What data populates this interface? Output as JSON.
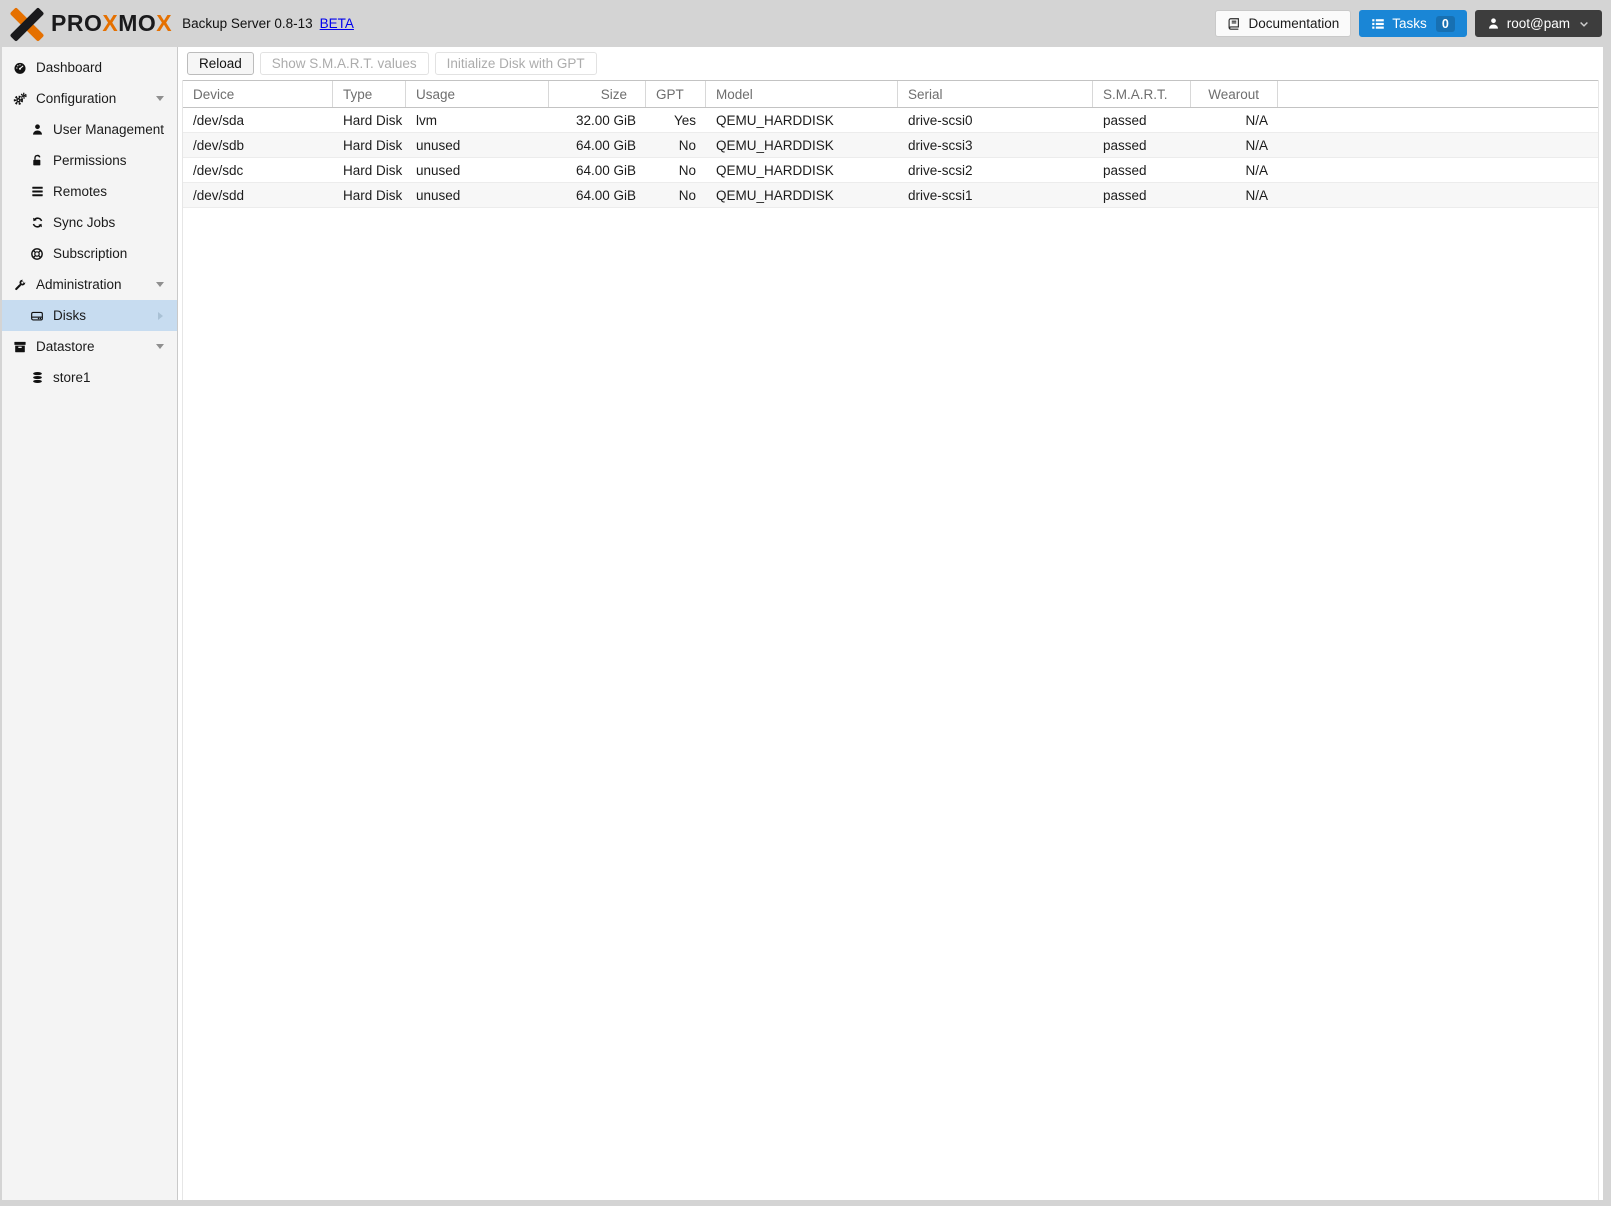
{
  "header": {
    "logo": {
      "part1": "PRO",
      "part2": "X",
      "part3": "MO",
      "part4": "X"
    },
    "product": "Backup Server 0.8-13",
    "beta": "BETA",
    "documentation_label": "Documentation",
    "tasks_label": "Tasks",
    "tasks_count": "0",
    "user": "root@pam"
  },
  "sidebar": {
    "items": [
      {
        "label": "Dashboard"
      },
      {
        "label": "Configuration"
      },
      {
        "label": "User Management"
      },
      {
        "label": "Permissions"
      },
      {
        "label": "Remotes"
      },
      {
        "label": "Sync Jobs"
      },
      {
        "label": "Subscription"
      },
      {
        "label": "Administration"
      },
      {
        "label": "Disks"
      },
      {
        "label": "Datastore"
      },
      {
        "label": "store1"
      }
    ]
  },
  "toolbar": {
    "reload_label": "Reload",
    "smart_label": "Show S.M.A.R.T. values",
    "init_gpt_label": "Initialize Disk with GPT"
  },
  "table": {
    "columns": [
      "Device",
      "Type",
      "Usage",
      "Size",
      "GPT",
      "Model",
      "Serial",
      "S.M.A.R.T.",
      "Wearout"
    ],
    "rows": [
      {
        "device": "/dev/sda",
        "type": "Hard Disk",
        "usage": "lvm",
        "size": "32.00 GiB",
        "gpt": "Yes",
        "model": "QEMU_HARDDISK",
        "serial": "drive-scsi0",
        "smart": "passed",
        "wearout": "N/A"
      },
      {
        "device": "/dev/sdb",
        "type": "Hard Disk",
        "usage": "unused",
        "size": "64.00 GiB",
        "gpt": "No",
        "model": "QEMU_HARDDISK",
        "serial": "drive-scsi3",
        "smart": "passed",
        "wearout": "N/A"
      },
      {
        "device": "/dev/sdc",
        "type": "Hard Disk",
        "usage": "unused",
        "size": "64.00 GiB",
        "gpt": "No",
        "model": "QEMU_HARDDISK",
        "serial": "drive-scsi2",
        "smart": "passed",
        "wearout": "N/A"
      },
      {
        "device": "/dev/sdd",
        "type": "Hard Disk",
        "usage": "unused",
        "size": "64.00 GiB",
        "gpt": "No",
        "model": "QEMU_HARDDISK",
        "serial": "drive-scsi1",
        "smart": "passed",
        "wearout": "N/A"
      }
    ]
  },
  "colors": {
    "brand_orange": "#e57000",
    "tasks_button_blue": "#1a86d6",
    "user_button_dark": "#3d3d3d",
    "selected_item_blue": "#c7dcf0",
    "beta_link_blue": "#0000ee",
    "chrome_gray": "#d4d4d4"
  }
}
